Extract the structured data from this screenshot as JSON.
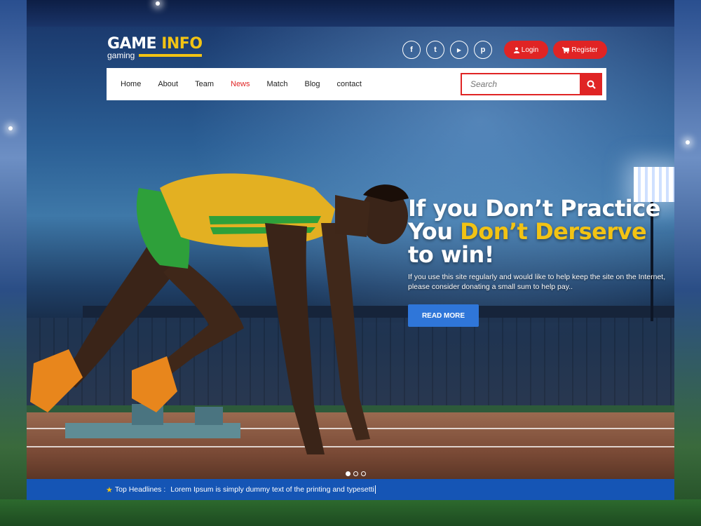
{
  "brand": {
    "title_main": "GAME",
    "title_accent": "INFO",
    "subtitle": "gaming",
    "accent_color": "#f2c314"
  },
  "socials": [
    {
      "icon": "facebook-icon",
      "glyph": "f"
    },
    {
      "icon": "twitter-icon",
      "glyph": "t"
    },
    {
      "icon": "youtube-icon",
      "glyph": "▶"
    },
    {
      "icon": "pinterest-icon",
      "glyph": "p"
    }
  ],
  "auth": {
    "login_label": "Login",
    "register_label": "Register",
    "button_color": "#e02424"
  },
  "nav": {
    "items": [
      "Home",
      "About",
      "Team",
      "News",
      "Match",
      "Blog",
      "contact"
    ],
    "active": "News"
  },
  "search": {
    "placeholder": "Search"
  },
  "hero": {
    "line1": "If you Don’t Practice",
    "line2_prefix": "You ",
    "line2_highlight": "Don’t Derserve",
    "line3": "to win!",
    "description": "If you use this site regularly and would like to help keep the site on the Internet, please consider donating a small sum to help pay..",
    "cta_label": "READ MORE"
  },
  "slider": {
    "count": 3,
    "active_index": 0
  },
  "ticker": {
    "label": "Top Headlines :",
    "text": "Lorem Ipsum is simply dummy text of the printing and typesetti",
    "background": "#1555b5"
  }
}
